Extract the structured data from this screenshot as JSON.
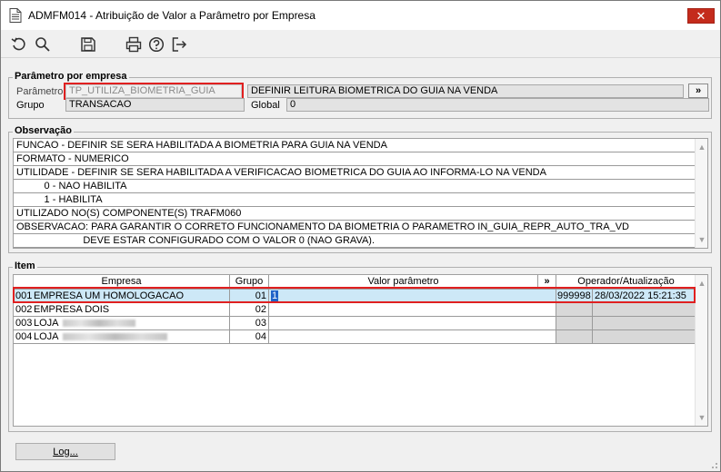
{
  "window": {
    "title": "ADMFM014 - Atribuição de Valor a Parâmetro por Empresa",
    "close_label": "✕"
  },
  "toolbar": {
    "buttons": [
      "undo-icon",
      "search-icon",
      "save-icon",
      "print-icon",
      "help-icon",
      "exit-icon"
    ]
  },
  "param_section": {
    "title": "Parâmetro por empresa",
    "parametro_label": "Parâmetro",
    "parametro_value": "TP_UTILIZA_BIOMETRIA_GUIA",
    "descricao_value": "DEFINIR LEITURA BIOMETRICA DO GUIA NA VENDA",
    "more_label": "»",
    "grupo_label": "Grupo",
    "grupo_value": "TRANSACAO",
    "global_label": "Global",
    "global_value": "0"
  },
  "observacao": {
    "title": "Observação",
    "lines": [
      "FUNCAO - DEFINIR SE SERA HABILITADA A BIOMETRIA PARA GUIA NA VENDA",
      "FORMATO - NUMERICO",
      "UTILIDADE - DEFINIR SE SERA HABILITADA A VERIFICACAO BIOMETRICA DO GUIA AO INFORMA-LO NA VENDA",
      "          0 - NAO HABILITA",
      "          1 - HABILITA",
      "UTILIZADO NO(S) COMPONENTE(S) TRAFM060",
      "OBSERVACAO: PARA GARANTIR O CORRETO FUNCIONAMENTO DA BIOMETRIA O PARAMETRO IN_GUIA_REPR_AUTO_TRA_VD",
      "                        DEVE ESTAR CONFIGURADO COM O VALOR 0 (NAO GRAVA)."
    ]
  },
  "item": {
    "title": "Item",
    "headers": {
      "empresa": "Empresa",
      "grupo": "Grupo",
      "valor": "Valor parâmetro",
      "more": "»",
      "operador": "Operador/Atualização"
    },
    "rows": [
      {
        "codigo": "001",
        "empresa": "EMPRESA UM HOMOLOGACAO",
        "grupo": "01",
        "valor": "1",
        "operador": "999998",
        "atualizacao": "28/03/2022 15:21:35"
      },
      {
        "codigo": "002",
        "empresa": "EMPRESA DOIS",
        "grupo": "02",
        "valor": "",
        "operador": "",
        "atualizacao": ""
      },
      {
        "codigo": "003",
        "empresa": "LOJA",
        "grupo": "03",
        "valor": "",
        "operador": "",
        "atualizacao": ""
      },
      {
        "codigo": "004",
        "empresa": "LOJA",
        "grupo": "04",
        "valor": "",
        "operador": "",
        "atualizacao": ""
      }
    ]
  },
  "footer": {
    "log_label": "Log..."
  },
  "colors": {
    "highlight_border": "#e02020",
    "selected_row": "#cde8f7",
    "close_button": "#c42b1c"
  }
}
